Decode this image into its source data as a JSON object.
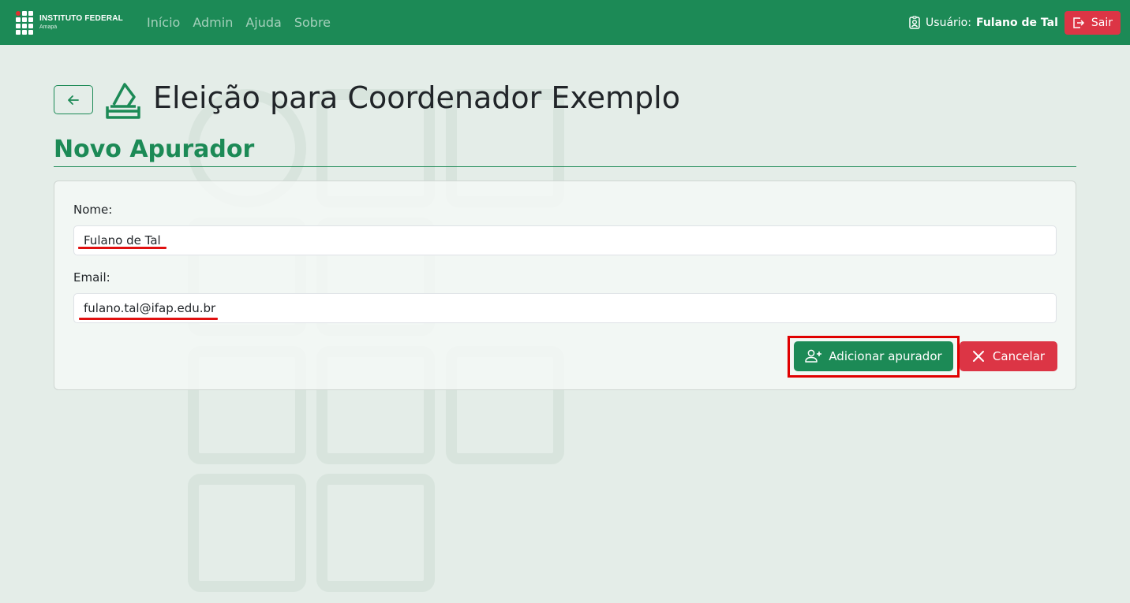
{
  "navbar": {
    "brand_name": "INSTITUTO FEDERAL",
    "brand_sub": "Amapá",
    "links": [
      "Início",
      "Admin",
      "Ajuda",
      "Sobre"
    ],
    "user_label": "Usuário:",
    "user_name": "Fulano de Tal",
    "logout_label": "Sair"
  },
  "header": {
    "title": "Eleição para Coordenador Exemplo",
    "section_title": "Novo Apurador"
  },
  "form": {
    "name_label": "Nome:",
    "name_value": "Fulano de Tal",
    "email_label": "Email:",
    "email_value": "fulano.tal@ifap.edu.br",
    "add_button": "Adicionar apurador",
    "cancel_button": "Cancelar"
  },
  "icons": {
    "back": "arrow-left-icon",
    "title": "ballot-box-icon",
    "user": "person-badge-icon",
    "logout": "box-arrow-right-icon",
    "add": "person-plus-icon",
    "cancel": "x-icon"
  },
  "colors": {
    "primary": "#1c8a56",
    "danger": "#dc3545",
    "background": "#e4ede8",
    "annotation": "#e00000"
  }
}
